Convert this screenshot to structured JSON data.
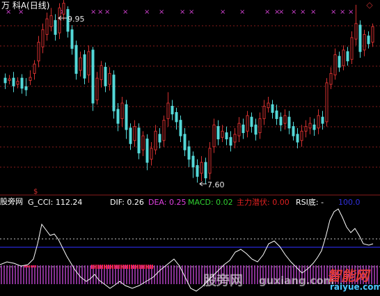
{
  "header": {
    "title": "万  科A(日线)",
    "corner_icon": "diamond-icon"
  },
  "price_chart": {
    "high_label": "9.95",
    "low_label": "7.60",
    "colors": {
      "up": "#d4302f",
      "down": "#54d8d8",
      "grid": "#8a1c1c",
      "marker": "#d040d0",
      "ma": "#ffffff"
    }
  },
  "indicator_bar": {
    "panel_name": "股旁网",
    "items": [
      {
        "label": "G_CCI: 112.24",
        "color": "#ffffff"
      },
      {
        "label": "DIF: 0.26",
        "color": "#ffffff"
      },
      {
        "label": "DEA: 0.25",
        "color": "#e040e0"
      },
      {
        "label": "MACD: 0.02",
        "color": "#30d030"
      },
      {
        "label": "主力潜伏: 0.00",
        "color": "#e02020"
      },
      {
        "label": "RSI底: -",
        "color": "#ffffff"
      },
      {
        "label": "100.0",
        "color": "#3030e0"
      }
    ]
  },
  "watermarks": {
    "left": "股旁网",
    "site": "guxiang.com",
    "brand": "智能网",
    "brand_url": "raiyue.com"
  }
}
